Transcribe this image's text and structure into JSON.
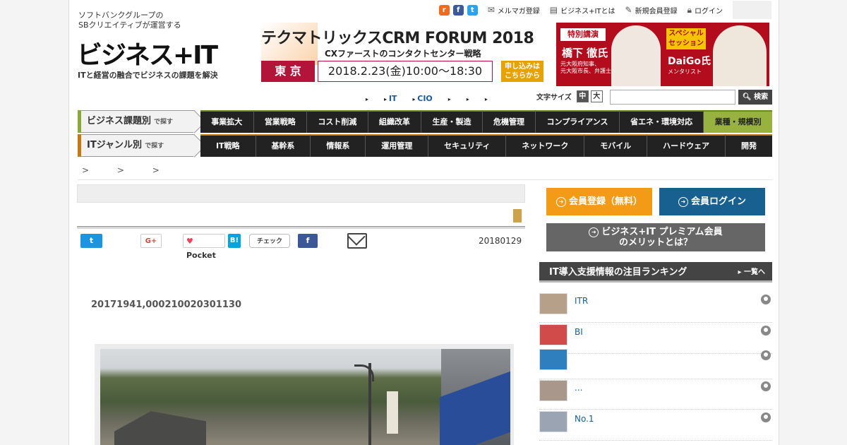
{
  "header": {
    "tagline": "ソフトバンクグループの\nSBクリエイティブが運営する",
    "logo": "ビジネス+IT",
    "subline": "ITと経営の融合でビジネスの課題を解決",
    "toplinks": {
      "mailmag": "メルマガ登録",
      "about": "ビジネス+ITとは",
      "register": "新規会員登録",
      "login": "ログイン"
    },
    "social": {
      "rss": "r",
      "fb": "f",
      "tw": "t"
    }
  },
  "banner_left": {
    "title": "テクマトリックスCRM FORUM 2018",
    "sub": "CXファーストのコンタクトセンター戦略",
    "location": "東 京",
    "date": "2018.2.23(金)10:00〜18:30",
    "apply": "申し込みは\nこちらから"
  },
  "banner_right": {
    "tag1": "特別講演",
    "name1": "橋下 徹氏",
    "desc1": "元大阪府知事、\n元大阪市長、弁護士",
    "tag2": "スペシャル\nセッション",
    "name2": "DaiGo氏",
    "desc2": "メンタリスト"
  },
  "subnav": [
    "",
    "IT",
    "CIO",
    "",
    "",
    ""
  ],
  "fontsize": {
    "label": "文字サイズ",
    "mid": "中",
    "large": "大"
  },
  "search": {
    "button": "検索",
    "placeholder": ""
  },
  "nav1": {
    "label": "ビジネス課題別",
    "small": "で探す",
    "items": [
      "事業拡大",
      "営業戦略",
      "コスト削減",
      "組織改革",
      "生産・製造",
      "危機管理",
      "コンプライアンス",
      "省エネ・環境対応",
      "業種・規模別"
    ]
  },
  "nav2": {
    "label": "ITジャンル別",
    "small": "で探す",
    "items": [
      "IT戦略",
      "基幹系",
      "情報系",
      "運用管理",
      "セキュリティ",
      "ネットワーク",
      "モバイル",
      "ハードウェア",
      "開発"
    ]
  },
  "breadcrumb": "> > >",
  "article": {
    "date": "20180129",
    "title": "",
    "subtitle": "20171941,000210020301130",
    "author": "",
    "share": {
      "twitter": "t",
      "gplus": "G+",
      "pocket": "Pocket",
      "hatena": "B!",
      "check": "チェック",
      "facebook": "f"
    }
  },
  "sidebar": {
    "register": "会員登録（無料）",
    "login": "会員ログイン",
    "premium": "ビジネス+IT プレミアム会員\nのメリットとは？",
    "ranking_title": "IT導入支援情報の注目ランキング",
    "ranking_more": "一覧へ",
    "ranking": [
      {
        "text": "ITR",
        "thumb": "#b7a08a"
      },
      {
        "text": "BI",
        "thumb": "#d24b4b"
      },
      {
        "text": "",
        "thumb": "#2f7fbf"
      },
      {
        "text": "...",
        "thumb": "#a8978a"
      },
      {
        "text": "No.1",
        "thumb": "#9aa4b3"
      }
    ]
  },
  "colors": {
    "accent_green": "#98b240",
    "accent_orange": "#f39a17",
    "accent_blue": "#17608f",
    "brand_red": "#b3143a"
  }
}
